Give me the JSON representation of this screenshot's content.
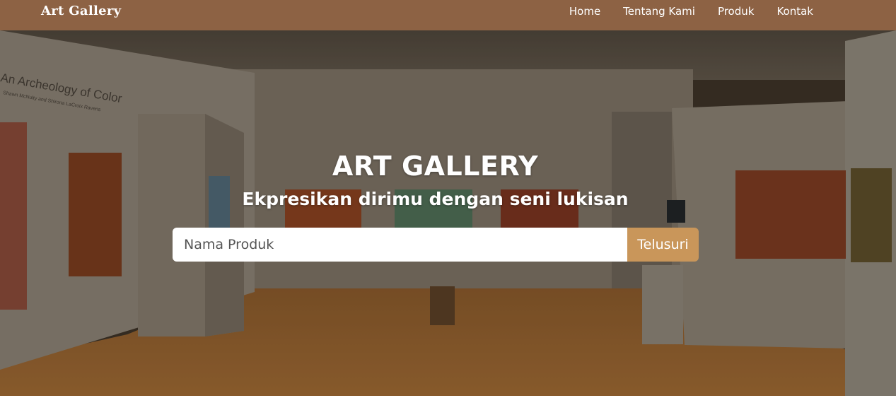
{
  "brand": "Art Gallery",
  "nav": {
    "items": [
      "Home",
      "Tentang Kami",
      "Produk",
      "Kontak"
    ]
  },
  "hero": {
    "title": "ART GALLERY",
    "subtitle": "Ekpresikan dirimu dengan seni lukisan",
    "wall_text": "An Archeology of Color",
    "wall_subtext": "Shawn McNulty and Shirona LaCroix Ravens"
  },
  "search": {
    "placeholder": "Nama Produk",
    "button_label": "Telusuri"
  },
  "colors": {
    "navbar": "#8d6244",
    "search_button": "#c9965a",
    "text": "#ffffff"
  }
}
